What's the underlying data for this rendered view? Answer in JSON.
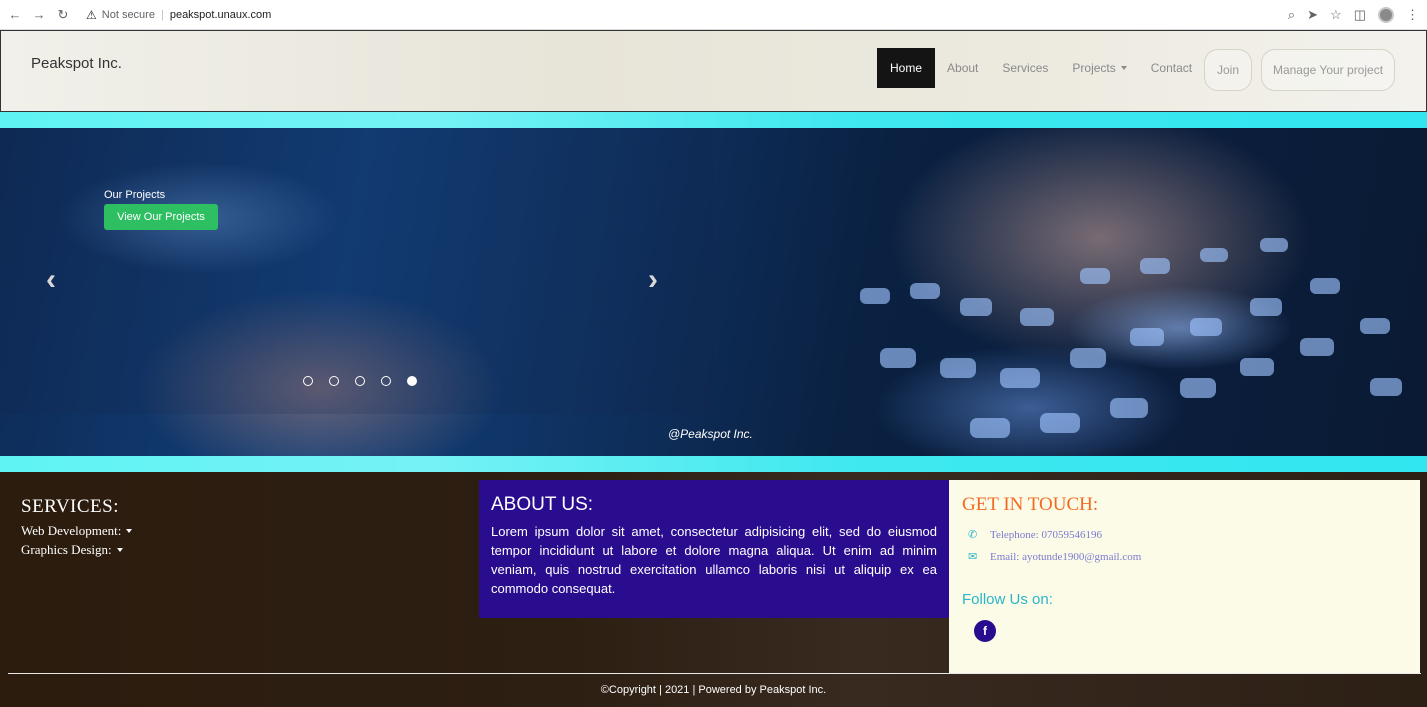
{
  "browser": {
    "security_label": "Not secure",
    "url": "peakspot.unaux.com"
  },
  "navbar": {
    "brand": "Peakspot Inc.",
    "menu": [
      "Home",
      "About",
      "Services",
      "Projects",
      "Contact"
    ],
    "join_label": "Join",
    "manage_label": "Manage Your project"
  },
  "hero": {
    "caption": "Our Projects",
    "cta_label": "View Our Projects",
    "credit": "@Peakspot Inc.",
    "slide_count": 5,
    "active_slide": 5
  },
  "services": {
    "title": "SERVICES:",
    "items": [
      "Web Development:",
      "Graphics Design:"
    ]
  },
  "about": {
    "title": "ABOUT US:",
    "text": "Lorem ipsum dolor sit amet, consectetur adipisicing elit, sed do eiusmod tempor incididunt ut labore et dolore magna aliqua. Ut enim ad minim veniam, quis nostrud exercitation ullamco laboris nisi ut aliquip ex ea commodo consequat."
  },
  "contact": {
    "title": "GET IN TOUCH:",
    "telephone": "Telephone: 07059546196",
    "email": "Email: ayotunde1900@gmail.com",
    "follow": "Follow Us on:",
    "facebook_glyph": "f"
  },
  "footer": {
    "copyright": "©Copyright | 2021 | Powered by Peakspot Inc."
  },
  "colors": {
    "accent_button": "#2dbf62",
    "about_bg": "#2a0d8f",
    "contact_title": "#f26a21",
    "cyan_strip": "#5ff3f4"
  }
}
